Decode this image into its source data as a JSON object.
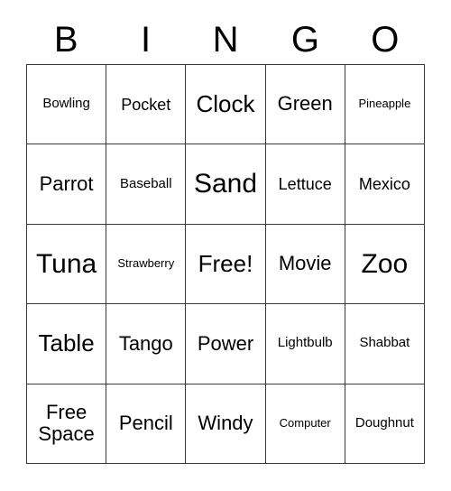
{
  "card": {
    "header_letters": [
      "B",
      "I",
      "N",
      "G",
      "O"
    ],
    "rows": [
      [
        {
          "label": "Bowling",
          "size": "xs"
        },
        {
          "label": "Pocket",
          "size": "sm"
        },
        {
          "label": "Clock",
          "size": "lg"
        },
        {
          "label": "Green",
          "size": "md"
        },
        {
          "label": "Pineapple",
          "size": "xxs"
        }
      ],
      [
        {
          "label": "Parrot",
          "size": "md"
        },
        {
          "label": "Baseball",
          "size": "xs"
        },
        {
          "label": "Sand",
          "size": "xl"
        },
        {
          "label": "Lettuce",
          "size": "sm"
        },
        {
          "label": "Mexico",
          "size": "sm"
        }
      ],
      [
        {
          "label": "Tuna",
          "size": "xl"
        },
        {
          "label": "Strawberry",
          "size": "xxs"
        },
        {
          "label": "Free!",
          "size": "lg"
        },
        {
          "label": "Movie",
          "size": "md"
        },
        {
          "label": "Zoo",
          "size": "xl"
        }
      ],
      [
        {
          "label": "Table",
          "size": "lg"
        },
        {
          "label": "Tango",
          "size": "md"
        },
        {
          "label": "Power",
          "size": "md"
        },
        {
          "label": "Lightbulb",
          "size": "xs"
        },
        {
          "label": "Shabbat",
          "size": "xs"
        }
      ],
      [
        {
          "label": "Free\nSpace",
          "size": "md"
        },
        {
          "label": "Pencil",
          "size": "md"
        },
        {
          "label": "Windy",
          "size": "md"
        },
        {
          "label": "Computer",
          "size": "xxs"
        },
        {
          "label": "Doughnut",
          "size": "xs"
        }
      ]
    ]
  },
  "colors": {
    "background": "#ffffff",
    "text": "#000000",
    "grid_line": "#3a3a3a"
  }
}
